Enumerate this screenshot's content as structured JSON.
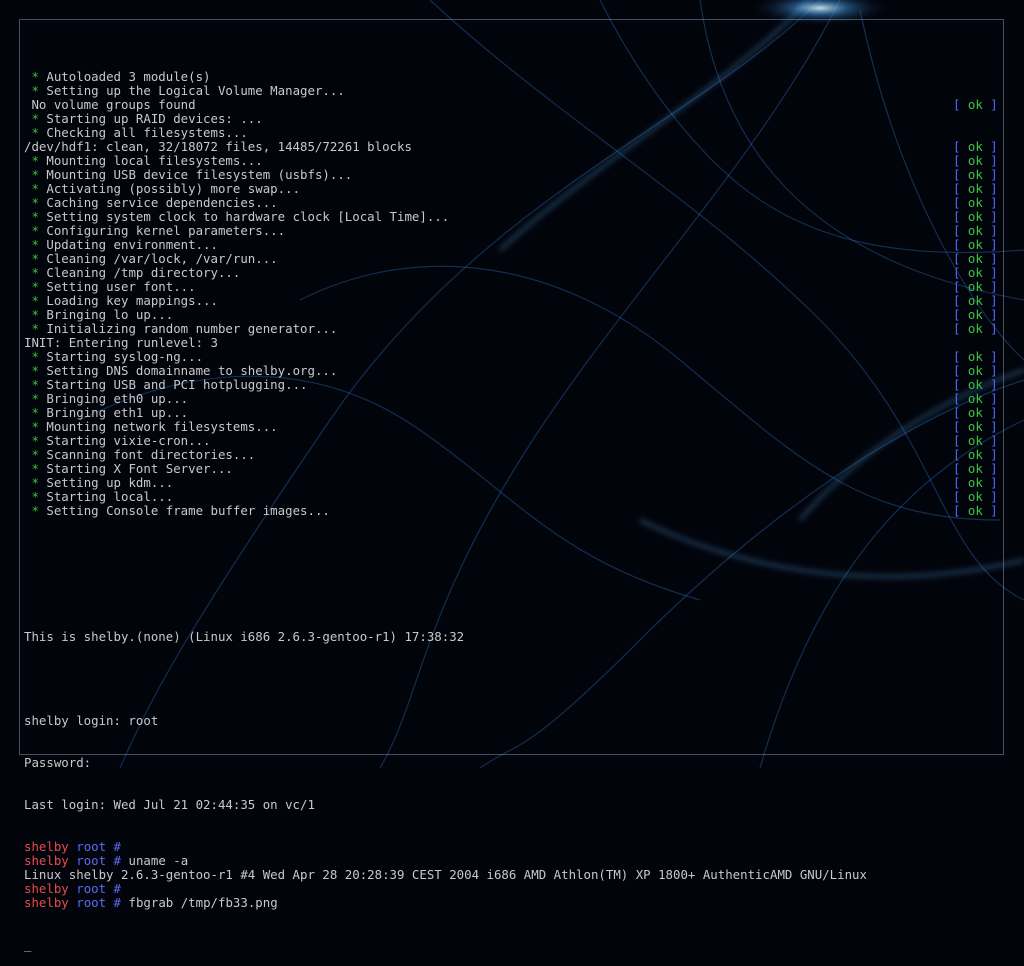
{
  "boot": [
    {
      "text": "Autoloaded 3 module(s)",
      "star": true,
      "ok": false
    },
    {
      "text": "Setting up the Logical Volume Manager...",
      "star": true,
      "ok": false
    },
    {
      "text": " No volume groups found",
      "star": false,
      "ok": true
    },
    {
      "text": "Starting up RAID devices: ...",
      "star": true,
      "ok": false
    },
    {
      "text": "Checking all filesystems...",
      "star": true,
      "ok": false
    },
    {
      "text": "/dev/hdf1: clean, 32/18072 files, 14485/72261 blocks",
      "star": false,
      "ok": true,
      "raw": true
    },
    {
      "text": "Mounting local filesystems...",
      "star": true,
      "ok": true
    },
    {
      "text": "Mounting USB device filesystem (usbfs)...",
      "star": true,
      "ok": true
    },
    {
      "text": "Activating (possibly) more swap...",
      "star": true,
      "ok": true
    },
    {
      "text": "Caching service dependencies...",
      "star": true,
      "ok": true
    },
    {
      "text": "Setting system clock to hardware clock [Local Time]...",
      "star": true,
      "ok": true
    },
    {
      "text": "Configuring kernel parameters...",
      "star": true,
      "ok": true
    },
    {
      "text": "Updating environment...",
      "star": true,
      "ok": true
    },
    {
      "text": "Cleaning /var/lock, /var/run...",
      "star": true,
      "ok": true
    },
    {
      "text": "Cleaning /tmp directory...",
      "star": true,
      "ok": true
    },
    {
      "text": "Setting user font...",
      "star": true,
      "ok": true
    },
    {
      "text": "Loading key mappings...",
      "star": true,
      "ok": true
    },
    {
      "text": "Bringing lo up...",
      "star": true,
      "ok": true
    },
    {
      "text": "Initializing random number generator...",
      "star": true,
      "ok": true
    },
    {
      "text": "INIT: Entering runlevel: 3",
      "star": false,
      "ok": false,
      "raw": true
    },
    {
      "text": "Starting syslog-ng...",
      "star": true,
      "ok": true
    },
    {
      "text": "Setting DNS domainname to shelby.org...",
      "star": true,
      "ok": true
    },
    {
      "text": "Starting USB and PCI hotplugging...",
      "star": true,
      "ok": true
    },
    {
      "text": "Bringing eth0 up...",
      "star": true,
      "ok": true
    },
    {
      "text": "Bringing eth1 up...",
      "star": true,
      "ok": true
    },
    {
      "text": "Mounting network filesystems...",
      "star": true,
      "ok": true
    },
    {
      "text": "Starting vixie-cron...",
      "star": true,
      "ok": true
    },
    {
      "text": "Scanning font directories...",
      "star": true,
      "ok": true
    },
    {
      "text": "Starting X Font Server...",
      "star": true,
      "ok": true
    },
    {
      "text": "Setting up kdm...",
      "star": true,
      "ok": true
    },
    {
      "text": "Starting local...",
      "star": true,
      "ok": true
    },
    {
      "text": "Setting Console frame buffer images...",
      "star": true,
      "ok": true
    }
  ],
  "ok_label": {
    "open": "[ ",
    "word": "ok",
    "close": " ]"
  },
  "star_glyph": " * ",
  "banner": "This is shelby.(none) (Linux i686 2.6.3-gentoo-r1) 17:38:32",
  "login": {
    "login_line": "shelby login: root",
    "password_line": "Password:",
    "last_login": "Last login: Wed Jul 21 02:44:35 on vc/1"
  },
  "prompt": {
    "host": "shelby",
    "dir": "root",
    "symbol": "#"
  },
  "session": [
    {
      "type": "prompt",
      "command": ""
    },
    {
      "type": "prompt",
      "command": "uname -a"
    },
    {
      "type": "output",
      "text": "Linux shelby 2.6.3-gentoo-r1 #4 Wed Apr 28 20:28:39 CEST 2004 i686 AMD Athlon(TM) XP 1800+ AuthenticAMD GNU/Linux"
    },
    {
      "type": "prompt",
      "command": ""
    },
    {
      "type": "prompt",
      "command": "fbgrab /tmp/fb33.png"
    }
  ],
  "cursor": "_"
}
